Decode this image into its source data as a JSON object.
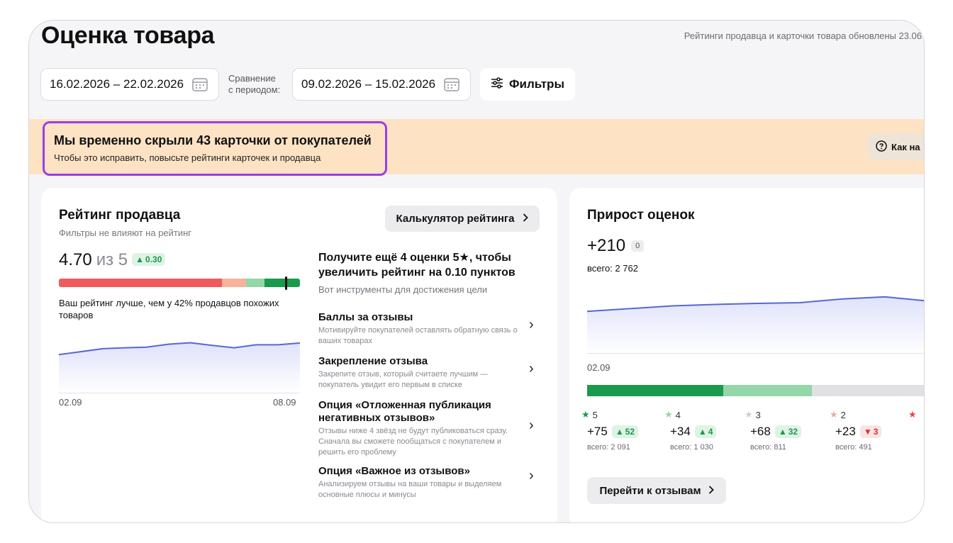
{
  "header": {
    "title": "Оценка товара",
    "updated_note": "Рейтинги продавца и карточки товара обновлены 23.06"
  },
  "filters": {
    "period": "16.02.2026 – 22.02.2026",
    "compare_label": "Сравнение\nс периодом:",
    "compare_period": "09.02.2026 – 15.02.2026",
    "filters_label": "Фильтры"
  },
  "banner": {
    "title": "Мы временно скрыли 43 карточки от покупателей",
    "subtitle": "Чтобы это исправить, повысьте рейтинги карточек и продавца",
    "howto_label": "Как на"
  },
  "seller_rating": {
    "title": "Рейтинг продавца",
    "subtitle": "Фильтры не влияют на рейтинг",
    "calculator_label": "Калькулятор рейтинга",
    "value": "4.70",
    "of_label": "из 5",
    "delta": "0.30",
    "scale_position": 0.94,
    "scale_colors": [
      "#f05a5a",
      "#f7b29a",
      "#93d6a8",
      "#1a9a4c",
      "#1a9a4c"
    ],
    "comparison_text": "Ваш рейтинг лучше, чем у 42% продавцов похожих товаров",
    "axis_start": "02.09",
    "axis_end": "08.09",
    "trend": [
      0.35,
      0.45,
      0.55,
      0.58,
      0.6,
      0.7,
      0.75,
      0.66,
      0.58,
      0.68,
      0.68,
      0.74
    ]
  },
  "goal": {
    "title": "Получите ещё 4 оценки 5★, чтобы увеличить рейтинг на 0.10 пунктов",
    "subtitle": "Вот инструменты для достижения цели",
    "tools": [
      {
        "title": "Баллы за отзывы",
        "desc": "Мотивируйте покупателей оставлять обратную связь о ваших товарах"
      },
      {
        "title": "Закрепление отзыва",
        "desc": "Закрепите отзыв, который считаете лучшим — покупатель увидит его первым в списке"
      },
      {
        "title": "Опция «Отложенная публикация негативных отзывов»",
        "desc": "Отзывы ниже 4 звёзд не будут публиковаться сразу. Сначала вы сможете пообщаться с покупателем и решить его проблему"
      },
      {
        "title": "Опция «Важное из отзывов»",
        "desc": "Анализируем отзывы на ваши товары и выделяем основные плюсы и минусы"
      }
    ]
  },
  "growth": {
    "title": "Прирост оценок",
    "value": "+210",
    "delta_badge": "0",
    "total": "всего: 2 762",
    "axis_start": "02.09",
    "trend": [
      0.3,
      0.38,
      0.46,
      0.5,
      0.53,
      0.55,
      0.66,
      0.72,
      0.6
    ],
    "distribution_colors": [
      "#1a9a4c",
      "#93d6a8",
      "#e1e1e5"
    ],
    "distribution": [
      0.4,
      0.26,
      0.34
    ],
    "stars": [
      {
        "label": "5",
        "star_color": "#1a9a4c",
        "delta": "+75",
        "change": "52",
        "dir": "up",
        "total": "всего: 2 091"
      },
      {
        "label": "4",
        "star_color": "#93d6a8",
        "delta": "+34",
        "change": "4",
        "dir": "up",
        "total": "всего: 1 030"
      },
      {
        "label": "3",
        "star_color": "#cfcfd4",
        "delta": "+68",
        "change": "32",
        "dir": "up",
        "total": "всего: 811"
      },
      {
        "label": "2",
        "star_color": "#f4a6a6",
        "delta": "+23",
        "change": "3",
        "dir": "down",
        "total": "всего: 491"
      }
    ],
    "reviews_button": "Перейти к отзывам"
  }
}
